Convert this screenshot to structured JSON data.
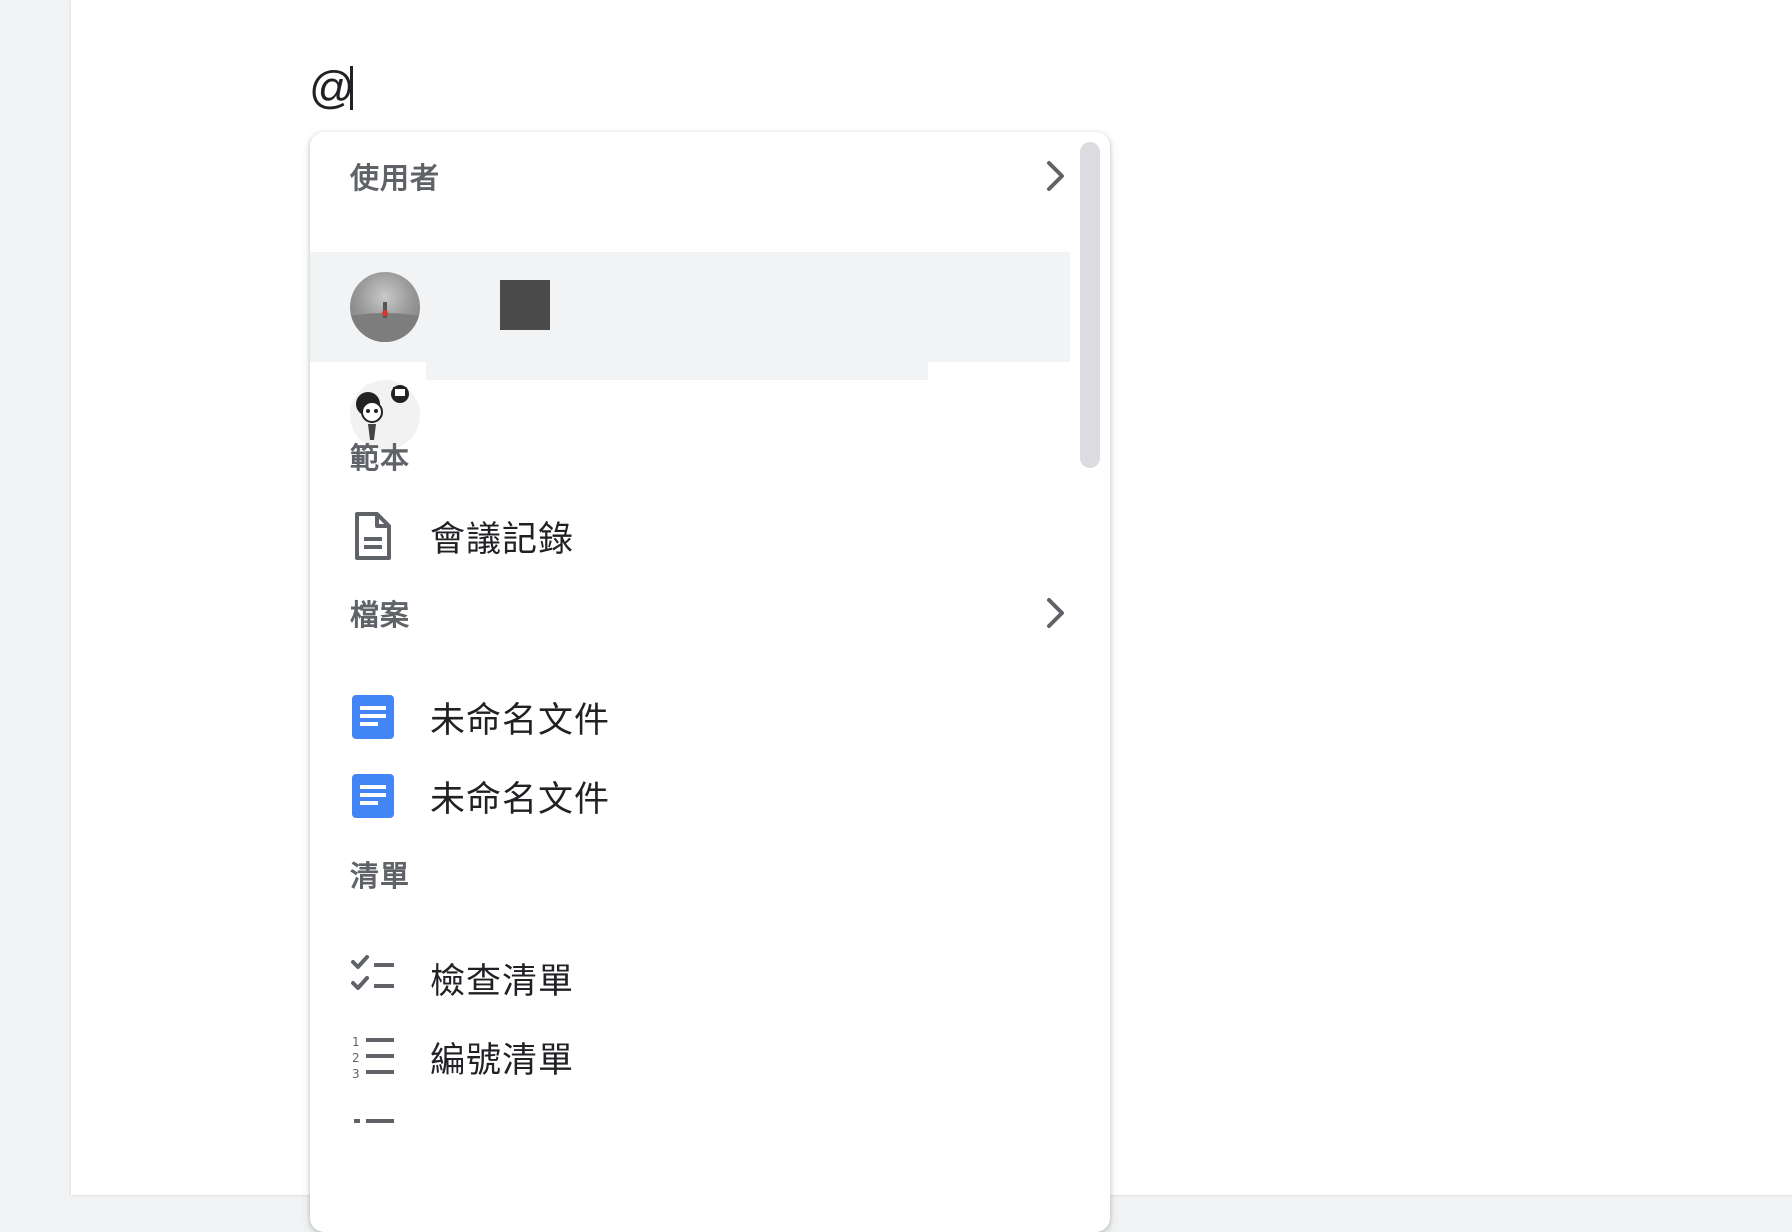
{
  "editor": {
    "typed_text": "@"
  },
  "menu": {
    "people": {
      "label": "使用者",
      "users": [
        {
          "avatar_icon": "user-photo-avatar"
        },
        {
          "avatar_icon": "user-cartoon-avatar"
        }
      ]
    },
    "templates": {
      "label": "範本",
      "items": [
        {
          "label": "會議記錄",
          "icon": "document-outline-icon"
        }
      ]
    },
    "files": {
      "label": "檔案",
      "items": [
        {
          "label": "未命名文件",
          "icon": "google-docs-icon"
        },
        {
          "label": "未命名文件",
          "icon": "google-docs-icon"
        }
      ]
    },
    "lists": {
      "label": "清單",
      "items": [
        {
          "label": "檢查清單",
          "icon": "checklist-icon"
        },
        {
          "label": "編號清單",
          "icon": "numbered-list-icon"
        }
      ]
    }
  },
  "colors": {
    "docs_blue": "#4285f4",
    "icon_gray": "#5f6368",
    "highlight": "#f1f3f4"
  }
}
